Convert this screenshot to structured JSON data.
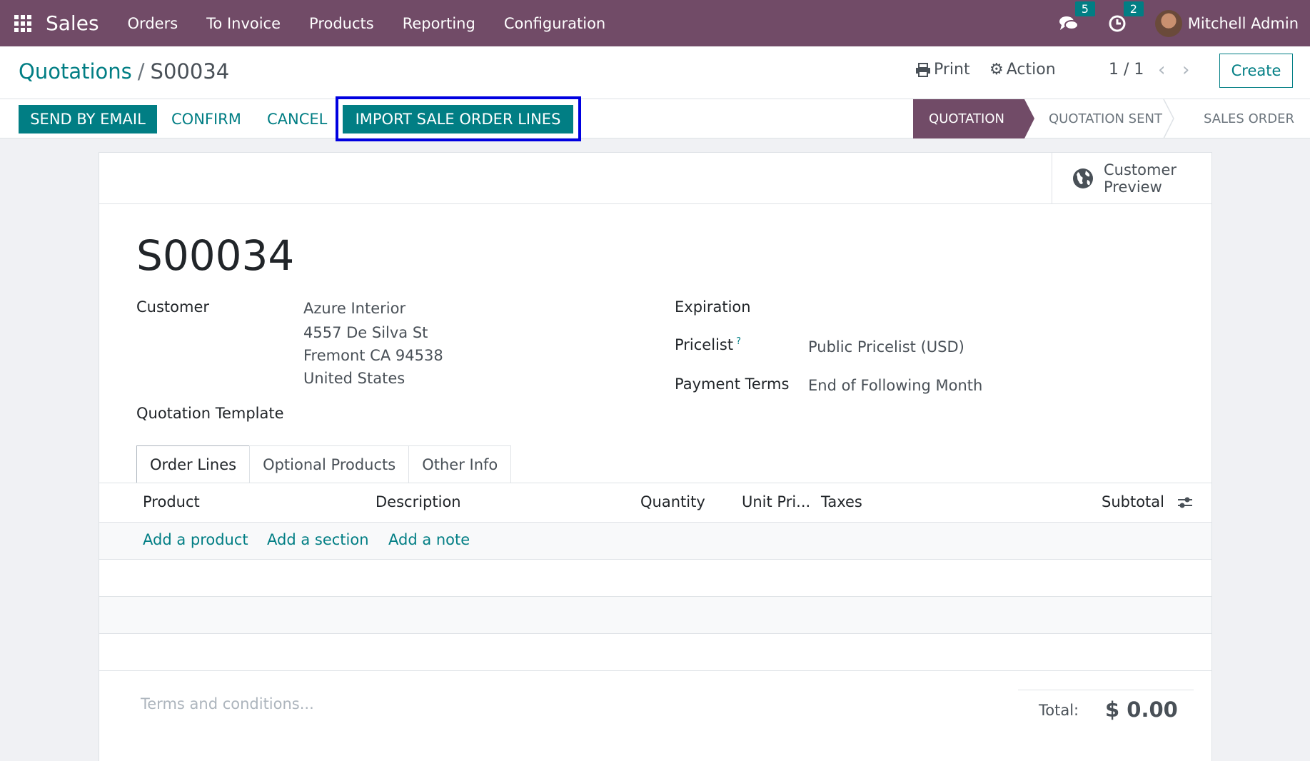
{
  "navbar": {
    "app_name": "Sales",
    "menu": [
      "Orders",
      "To Invoice",
      "Products",
      "Reporting",
      "Configuration"
    ],
    "messages_count": "5",
    "activities_count": "2",
    "user_name": "Mitchell Admin"
  },
  "control_panel": {
    "breadcrumb_parent": "Quotations",
    "breadcrumb_separator": "/",
    "breadcrumb_current": "S00034",
    "print_label": "Print",
    "action_label": "Action",
    "pager": "1 / 1",
    "create_label": "Create"
  },
  "header_buttons": {
    "send_by_email": "SEND BY EMAIL",
    "confirm": "CONFIRM",
    "cancel": "CANCEL",
    "import_lines": "IMPORT SALE ORDER LINES"
  },
  "statusbar": {
    "stages": [
      "QUOTATION",
      "QUOTATION SENT",
      "SALES ORDER"
    ],
    "active": "QUOTATION"
  },
  "sheet": {
    "customer_preview_line1": "Customer",
    "customer_preview_line2": "Preview",
    "record_name": "S00034",
    "customer_label": "Customer",
    "customer_address": [
      "Azure Interior",
      "4557 De Silva St",
      "Fremont CA 94538",
      "United States"
    ],
    "quotation_template_label": "Quotation Template",
    "expiration_label": "Expiration",
    "pricelist_label": "Pricelist",
    "pricelist_help": "?",
    "pricelist_value": "Public Pricelist (USD)",
    "payment_terms_label": "Payment Terms",
    "payment_terms_value": "End of Following Month"
  },
  "tabs": [
    "Order Lines",
    "Optional Products",
    "Other Info"
  ],
  "order_lines": {
    "columns": [
      "Product",
      "Description",
      "Quantity",
      "Unit Pri...",
      "Taxes",
      "Subtotal"
    ],
    "add_product": "Add a product",
    "add_section": "Add a section",
    "add_note": "Add a note"
  },
  "footer": {
    "terms_placeholder": "Terms and conditions...",
    "total_label": "Total:",
    "total_value": "$ 0.00"
  },
  "colors": {
    "brand": "#714b67",
    "accent": "#017e84",
    "highlight": "#0000e0"
  }
}
